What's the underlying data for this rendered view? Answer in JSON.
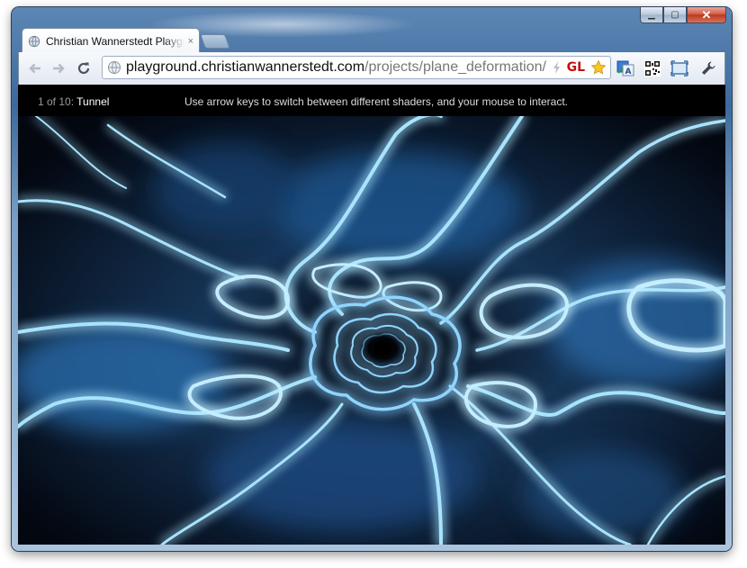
{
  "window": {
    "buttons": {
      "minimize": "▁",
      "maximize": "▢",
      "close": "✕"
    }
  },
  "tabs": [
    {
      "title": "Christian Wannerstedt Playground",
      "active": true,
      "close": "×"
    }
  ],
  "toolbar": {
    "icons": [
      "back-arrow-icon",
      "forward-arrow-icon",
      "reload-icon",
      "wrench-icon"
    ],
    "omnibox": {
      "url_host": "playground.christianwannerstedt.com",
      "url_path": "/projects/plane_deformation/",
      "gl_badge": "GL"
    },
    "extension_icons": [
      "lightning-icon",
      "star-icon",
      "translate-icon",
      "qr-code-icon",
      "fullscreen-icon"
    ]
  },
  "page": {
    "counter_prefix": "1 of 10: ",
    "shader_name": "Tunnel",
    "instructions": "Use arrow keys to switch between different shaders, and your mouse to interact."
  },
  "colors": {
    "canvas_bg": "#02060f",
    "glow": "#9fe0ff",
    "header_bg": "#000000"
  }
}
